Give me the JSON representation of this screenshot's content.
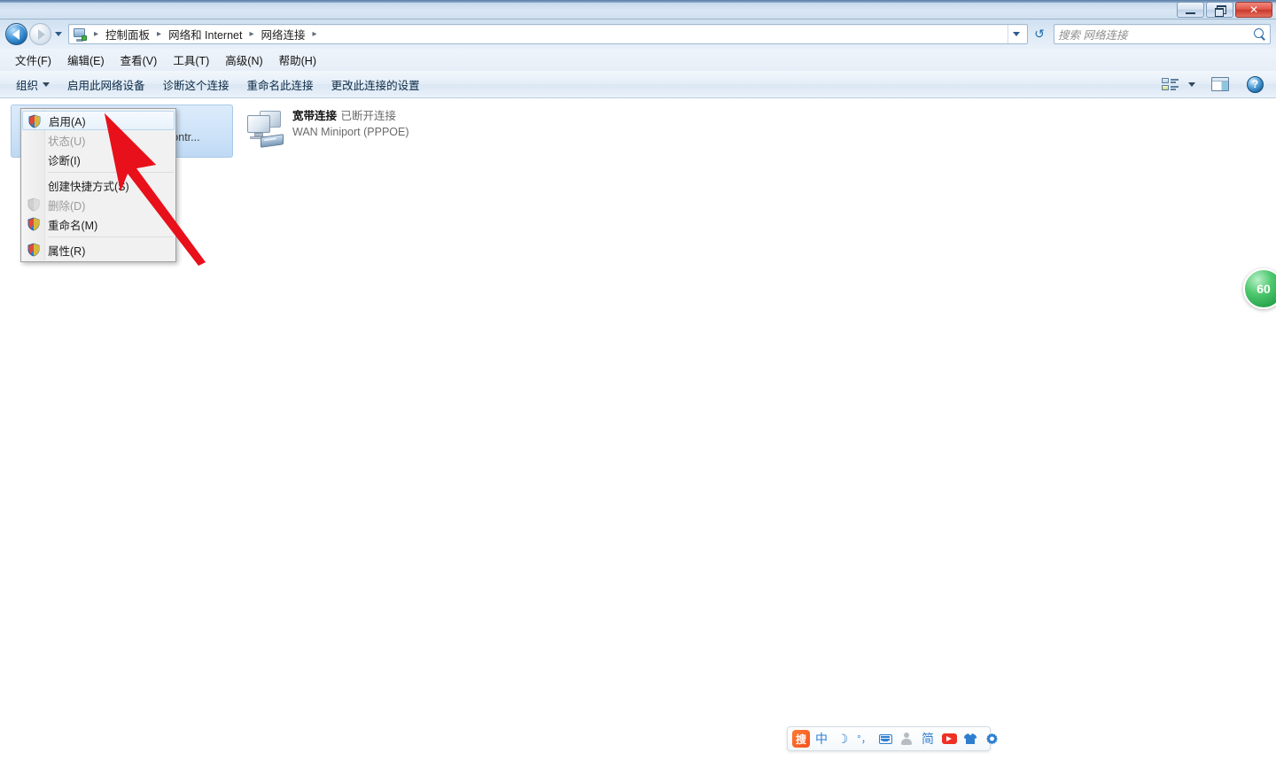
{
  "window": {
    "title": "",
    "buttons": {
      "minimize": "─",
      "maximize": "❐",
      "close": "✕"
    }
  },
  "address_bar": {
    "back_icon": "back-arrow-icon",
    "forward_icon": "forward-arrow-icon",
    "history_caret": "chevron-down-icon",
    "location_icon": "network-connections-icon",
    "breadcrumbs": [
      "控制面板",
      "网络和 Internet",
      "网络连接"
    ],
    "separator": "▸",
    "dropdown_caret": "chevron-down-icon",
    "refresh_icon": "refresh-icon",
    "search_placeholder": "搜索 网络连接",
    "search_value": "",
    "search_icon": "search-icon"
  },
  "menubar": {
    "items": [
      {
        "label": "文件(F)"
      },
      {
        "label": "编辑(E)"
      },
      {
        "label": "查看(V)"
      },
      {
        "label": "工具(T)"
      },
      {
        "label": "高级(N)"
      },
      {
        "label": "帮助(H)"
      }
    ]
  },
  "toolbar": {
    "organize_label": "组织",
    "items": [
      {
        "label": "启用此网络设备"
      },
      {
        "label": "诊断这个连接"
      },
      {
        "label": "重命名此连接"
      },
      {
        "label": "更改此连接的设置"
      }
    ],
    "right_icons": [
      {
        "name": "change-view-icon"
      },
      {
        "name": "chevron-down-icon"
      },
      {
        "name": "preview-pane-icon"
      },
      {
        "name": "help-icon",
        "label": "?"
      }
    ]
  },
  "connections": [
    {
      "selected": true,
      "icon": "network-connection-icon",
      "clipped_label": "ily Contr...",
      "name": "",
      "status": "",
      "device": ""
    },
    {
      "selected": false,
      "icon": "network-connection-icon",
      "name": "宽带连接",
      "status": "已断开连接",
      "device": "WAN Miniport (PPPOE)"
    }
  ],
  "context_menu": {
    "items": [
      {
        "label": "启用(A)",
        "shield": true,
        "disabled": false,
        "highlighted": true,
        "separator_after": false
      },
      {
        "label": "状态(U)",
        "shield": false,
        "disabled": true,
        "highlighted": false,
        "separator_after": false
      },
      {
        "label": "诊断(I)",
        "shield": false,
        "disabled": false,
        "highlighted": false,
        "separator_after": true
      },
      {
        "label": "创建快捷方式(S)",
        "shield": false,
        "disabled": false,
        "highlighted": false,
        "separator_after": false
      },
      {
        "label": "删除(D)",
        "shield": true,
        "disabled": true,
        "highlighted": false,
        "separator_after": false
      },
      {
        "label": "重命名(M)",
        "shield": true,
        "disabled": false,
        "highlighted": false,
        "separator_after": true
      },
      {
        "label": "属性(R)",
        "shield": true,
        "disabled": false,
        "highlighted": false,
        "separator_after": false
      }
    ]
  },
  "annotation": {
    "arrow_color": "#e8101a",
    "arrow_name": "red-pointer-arrow"
  },
  "floating_badge": {
    "label": "60",
    "color": "#2fab53"
  },
  "ime_bar": {
    "logo_label": "搜",
    "items": [
      {
        "name": "sogou-logo-icon",
        "label": "搜"
      },
      {
        "name": "chinese-mode-icon",
        "label": "中"
      },
      {
        "name": "moon-icon",
        "label": "☽"
      },
      {
        "name": "punctuation-mode-icon",
        "label": "°，"
      },
      {
        "name": "soft-keyboard-icon",
        "label": ""
      },
      {
        "name": "user-account-icon",
        "label": ""
      },
      {
        "name": "simplified-chinese-icon",
        "label": "简"
      },
      {
        "name": "video-record-icon",
        "label": ""
      },
      {
        "name": "skin-icon",
        "label": ""
      },
      {
        "name": "settings-gear-icon",
        "label": ""
      }
    ]
  }
}
